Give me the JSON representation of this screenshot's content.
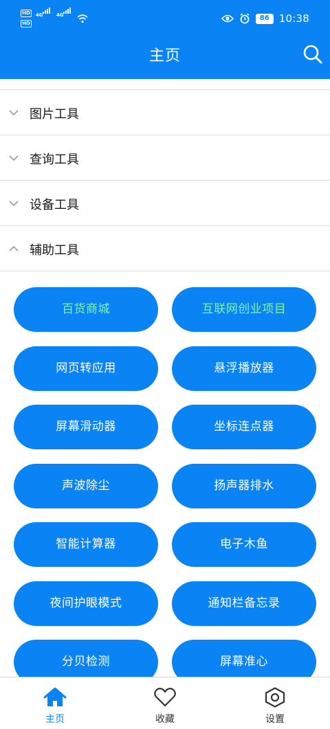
{
  "status_bar": {
    "hd": "HD",
    "net": "4G",
    "battery": "86",
    "time": "10:38"
  },
  "header": {
    "title": "主页"
  },
  "sections": [
    {
      "label": "图片工具",
      "expanded": false
    },
    {
      "label": "查询工具",
      "expanded": false
    },
    {
      "label": "设备工具",
      "expanded": false
    },
    {
      "label": "辅助工具",
      "expanded": true
    }
  ],
  "tools": [
    {
      "label": "百货商城",
      "highlight": true
    },
    {
      "label": "互联网创业项目",
      "highlight": true
    },
    {
      "label": "网页转应用"
    },
    {
      "label": "悬浮播放器"
    },
    {
      "label": "屏幕滑动器"
    },
    {
      "label": "坐标连点器"
    },
    {
      "label": "声波除尘"
    },
    {
      "label": "扬声器排水"
    },
    {
      "label": "智能计算器"
    },
    {
      "label": "电子木鱼"
    },
    {
      "label": "夜间护眼模式"
    },
    {
      "label": "通知栏备忘录"
    },
    {
      "label": "分贝检测"
    },
    {
      "label": "屏幕准心"
    }
  ],
  "tabs": [
    {
      "label": "主页",
      "icon": "home-icon",
      "active": true
    },
    {
      "label": "收藏",
      "icon": "heart-icon"
    },
    {
      "label": "设置",
      "icon": "settings-icon"
    }
  ],
  "colors": {
    "primary": "#0a84f5",
    "highlight_text": "#7ef5a9",
    "divider": "#dcdcdc"
  }
}
